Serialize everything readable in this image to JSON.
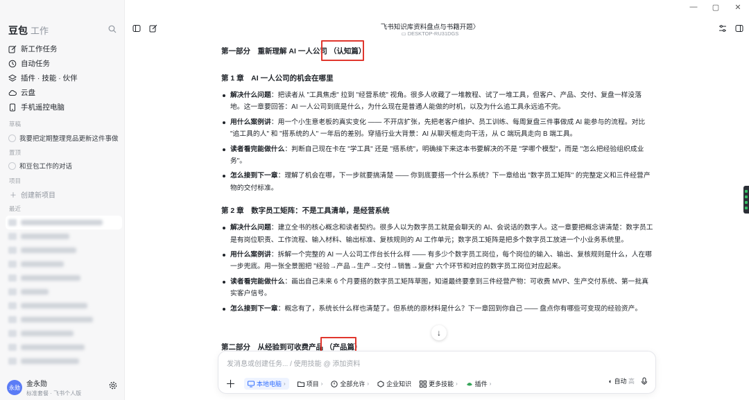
{
  "window": {
    "controls": [
      "—",
      "▢",
      "✕"
    ]
  },
  "sidebar": {
    "brand": "豆包",
    "brand_sub": "工作",
    "nav": [
      {
        "label": "新工作任务",
        "icon": "edit-icon"
      },
      {
        "label": "自动任务",
        "icon": "clock-icon"
      },
      {
        "label": "插件 · 技能 · 伙伴",
        "icon": "layers-icon"
      },
      {
        "label": "云盘",
        "icon": "cloud-icon"
      },
      {
        "label": "手机遥控电脑",
        "icon": "phone-icon"
      }
    ],
    "sections": {
      "drafts": "草稿",
      "pinned": "置顶",
      "projects": "项目",
      "recent": "最近"
    },
    "draft_item": "我要把定期整理竞品更新这件事做",
    "pinned_item": "和豆包工作的对话",
    "new_project": "创建新项目",
    "user": {
      "avatar_text": "永勋",
      "name": "金永勋",
      "plan": "标准套餐 · 飞书个人版"
    }
  },
  "header": {
    "title": "飞书知识库资料盘点与书籍开题",
    "title_chevron": "〉",
    "device": "DESKTOP-RU31DGS"
  },
  "content": {
    "part1": {
      "title": "第一部分　重新理解 AI 一人公司",
      "highlight": "（认知篇）"
    },
    "chapter1": {
      "title": "第 1 章　AI 一人公司的机会在哪里",
      "bullets": [
        {
          "label": "解决什么问题",
          "text": "：把读者从 \"工具焦虑\" 拉到 \"经营系统\" 视角。很多人收藏了一堆教程、试了一堆工具，但客户、产品、交付、复盘一样没落地。这一章要回答：AI 一人公司到底是什么，为什么现在是普通人能做的时机，以及为什么追工具永远追不完。"
        },
        {
          "label": "用什么案例讲",
          "text": "：用一个小生意老板的真实变化 —— 不开店扩张，先把老客户维护、员工训练、每周复盘三件事做成 AI 能参与的流程。对比 \"追工具的人\" 和 \"搭系统的人\" 一年后的差别。穿插行业大背景：AI 从聊天框走向干活，从 C 端玩具走向 B 端工具。"
        },
        {
          "label": "读者看完能做什么",
          "text": "：判断自己现在卡在 \"学工具\" 还是 \"搭系统\"，明确接下来这本书要解决的不是 \"学哪个模型\"，而是 \"怎么把经验组织成业务\"。"
        },
        {
          "label": "怎么接到下一章",
          "text": "：理解了机会在哪，下一步就要搞清楚 —— 你到底要搭一个什么系统？下一章给出 \"数字员工矩阵\" 的完整定义和三件经营产物的交付标准。"
        }
      ]
    },
    "chapter2": {
      "title": "第 2 章　数字员工矩阵：不是工具清单，是经营系统",
      "bullets": [
        {
          "label": "解决什么问题",
          "text": "：建立全书的核心概念和读者契约。很多人以为数字员工就是会聊天的 AI、会说话的数字人。这一章要把概念讲清楚：数字员工是有岗位职责、工作流程、输入材料、输出标准、复核规则的 AI 工作单元；数字员工矩阵是把多个数字员工放进一个小业务系统里。"
        },
        {
          "label": "用什么案例讲",
          "text": "：拆解一个完整的 AI 一人公司工作台长什么样 —— 有多少个数字员工岗位，每个岗位的输入、输出、复核规则是什么，人在哪一步兜底。用一张全景图把 \"经验→产品→生产→交付→销售→复盘\" 六个环节和对应的数字员工岗位对应起来。"
        },
        {
          "label": "读者看完能做什么",
          "text": "：画出自己未来 6 个月要搭的数字员工矩阵草图，知道最终要拿到三件经营产物：可收费 MVP、生产交付系统、第一批真实客户信号。"
        },
        {
          "label": "怎么接到下一章",
          "text": "：概念有了，系统长什么样也清楚了。但系统的原材料是什么？下一章回到你自己 —— 盘点你有哪些可变现的经验资产。"
        }
      ]
    },
    "part2": {
      "title": "第二部分　从经验到可收费产品",
      "highlight": "（产品篇）"
    }
  },
  "composer": {
    "placeholder": "发消息或创建任务... / 使用技能 @ 添加资料",
    "tools": [
      {
        "label": "本地电脑",
        "icon": "monitor-icon",
        "chevron": "›"
      },
      {
        "label": "项目",
        "icon": "folder-icon",
        "chevron": "›"
      },
      {
        "label": "全部允许",
        "icon": "shield-icon",
        "chevron": "›"
      },
      {
        "label": "企业知识",
        "icon": "org-icon",
        "chevron": ""
      },
      {
        "label": "更多技能",
        "icon": "grid-icon",
        "chevron": "›"
      },
      {
        "label": "插件",
        "icon": "plugin-icon",
        "chevron": "›"
      }
    ],
    "mode": "自动",
    "mode_level": "高"
  }
}
